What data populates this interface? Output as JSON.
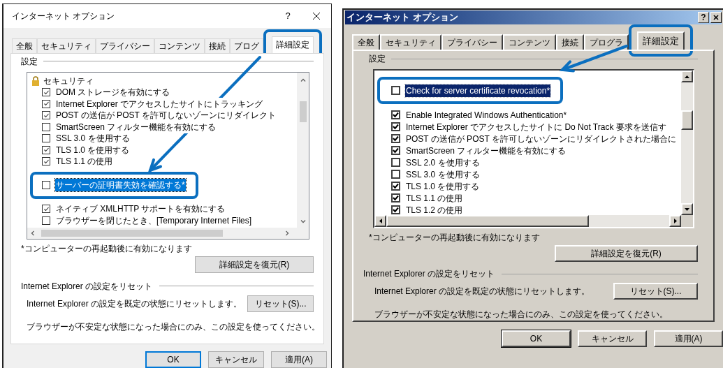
{
  "dialogs": [
    {
      "kind": "modern",
      "title": "インターネット オプション",
      "help": "?",
      "tabs": [
        {
          "label": "全般",
          "selected": false,
          "highlighted": false
        },
        {
          "label": "セキュリティ",
          "selected": false,
          "highlighted": false
        },
        {
          "label": "プライバシー",
          "selected": false,
          "highlighted": false
        },
        {
          "label": "コンテンツ",
          "selected": false,
          "highlighted": false
        },
        {
          "label": "接続",
          "selected": false,
          "highlighted": false
        },
        {
          "label": "プログ",
          "selected": false,
          "highlighted": false
        },
        {
          "label": "詳細設定",
          "selected": true,
          "highlighted": true
        }
      ],
      "group_label": "設定",
      "items": [
        {
          "kind": "category",
          "label": "セキュリティ"
        },
        {
          "kind": "checkbox",
          "label": "DOM ストレージを有効にする",
          "checked": true,
          "selected": false,
          "highlighted": false
        },
        {
          "kind": "checkbox",
          "label": "Internet Explorer でアクセスしたサイトにトラッキング",
          "checked": true,
          "selected": false,
          "highlighted": false
        },
        {
          "kind": "checkbox",
          "label": "POST の送信が POST を許可しないゾーンにリダイレクト",
          "checked": true,
          "selected": false,
          "highlighted": false
        },
        {
          "kind": "checkbox",
          "label": "SmartScreen フィルター機能を有効にする",
          "checked": false,
          "selected": false,
          "highlighted": false
        },
        {
          "kind": "checkbox",
          "label": "SSL 3.0 を使用する",
          "checked": false,
          "selected": false,
          "highlighted": false
        },
        {
          "kind": "checkbox",
          "label": "TLS 1.0 を使用する",
          "checked": true,
          "selected": false,
          "highlighted": false
        },
        {
          "kind": "checkbox",
          "label": "TLS 1.1 の使用",
          "checked": true,
          "selected": false,
          "highlighted": false
        },
        {
          "kind": "obscured"
        },
        {
          "kind": "checkbox",
          "label": "サーバーの証明書失効を確認する*",
          "checked": false,
          "selected": true,
          "highlighted": true
        },
        {
          "kind": "obscured"
        },
        {
          "kind": "checkbox",
          "label": "ネイティブ XMLHTTP サポートを有効にする",
          "checked": true,
          "selected": false,
          "highlighted": false
        },
        {
          "kind": "checkbox",
          "label": "ブラウザーを閉じたとき、[Temporary Internet Files]",
          "checked": false,
          "selected": false,
          "highlighted": false
        }
      ],
      "note": "*コンピューターの再起動後に有効になります",
      "restore_button": "詳細設定を復元(R)",
      "reset_group_label": "Internet Explorer の設定をリセット",
      "reset_text": "Internet Explorer の設定を既定の状態にリセットします。",
      "reset_button": "リセット(S)...",
      "warning": "ブラウザーが不安定な状態になった場合にのみ、この設定を使ってください。",
      "buttons": [
        {
          "label": "OK",
          "default": true
        },
        {
          "label": "キャンセル",
          "default": false
        },
        {
          "label": "適用(A)",
          "default": false
        }
      ]
    },
    {
      "kind": "classic",
      "title": "インターネット オプション",
      "help": "?",
      "tabs": [
        {
          "label": "全般",
          "selected": false,
          "highlighted": false
        },
        {
          "label": "セキュリティ",
          "selected": false,
          "highlighted": false
        },
        {
          "label": "プライバシー",
          "selected": false,
          "highlighted": false
        },
        {
          "label": "コンテンツ",
          "selected": false,
          "highlighted": false
        },
        {
          "label": "接続",
          "selected": false,
          "highlighted": false
        },
        {
          "label": "プログラ",
          "selected": false,
          "highlighted": false
        },
        {
          "label": "詳細設定",
          "selected": true,
          "highlighted": true
        }
      ],
      "group_label": "設定",
      "items": [
        {
          "kind": "obscured"
        },
        {
          "kind": "checkbox",
          "label": "Check for server certificate revocation*",
          "checked": false,
          "selected": true,
          "highlighted": true
        },
        {
          "kind": "obscured"
        },
        {
          "kind": "checkbox",
          "label": "Enable Integrated Windows Authentication*",
          "checked": true,
          "selected": false,
          "highlighted": false
        },
        {
          "kind": "checkbox",
          "label": "Internet Explorer でアクセスしたサイトに Do Not Track 要求を送信す",
          "checked": true,
          "selected": false,
          "highlighted": false
        },
        {
          "kind": "checkbox",
          "label": "POST の送信が POST を許可しないゾーンにリダイレクトされた場合に",
          "checked": true,
          "selected": false,
          "highlighted": false
        },
        {
          "kind": "checkbox",
          "label": "SmartScreen フィルター機能を有効にする",
          "checked": true,
          "selected": false,
          "highlighted": false
        },
        {
          "kind": "checkbox",
          "label": "SSL 2.0 を使用する",
          "checked": false,
          "selected": false,
          "highlighted": false
        },
        {
          "kind": "checkbox",
          "label": "SSL 3.0 を使用する",
          "checked": false,
          "selected": false,
          "highlighted": false
        },
        {
          "kind": "checkbox",
          "label": "TLS 1.0 を使用する",
          "checked": true,
          "selected": false,
          "highlighted": false
        },
        {
          "kind": "checkbox",
          "label": "TLS 1.1 の使用",
          "checked": true,
          "selected": false,
          "highlighted": false
        },
        {
          "kind": "checkbox",
          "label": "TLS 1.2 の使用",
          "checked": true,
          "selected": false,
          "highlighted": false
        }
      ],
      "note": "*コンピューターの再起動後に有効になります",
      "restore_button": "詳細設定を復元(R)",
      "reset_group_label": "Internet Explorer の設定をリセット",
      "reset_text": "Internet Explorer の設定を既定の状態にリセットします。",
      "reset_button": "リセット(S)...",
      "warning": "ブラウザーが不安定な状態になった場合にのみ、この設定を使ってください。",
      "buttons": [
        {
          "label": "OK",
          "default": true
        },
        {
          "label": "キャンセル",
          "default": false
        },
        {
          "label": "適用(A)",
          "default": false
        }
      ]
    }
  ]
}
